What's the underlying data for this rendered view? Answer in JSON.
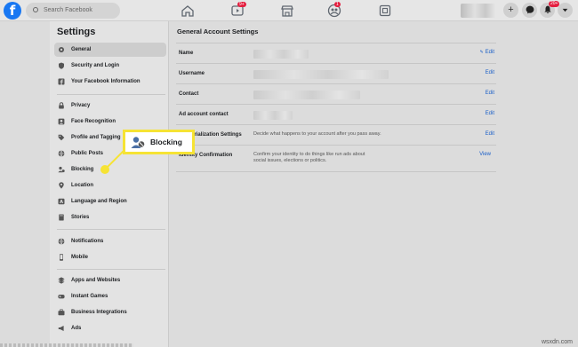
{
  "topbar": {
    "search_placeholder": "Search Facebook",
    "video_badge": "9+",
    "groups_badge": "1",
    "bell_badge": "20+"
  },
  "sidebar": {
    "title": "Settings",
    "items": [
      {
        "label": "General",
        "icon": "gear-icon"
      },
      {
        "label": "Security and Login",
        "icon": "shield-icon"
      },
      {
        "label": "Your Facebook Information",
        "icon": "facebook-icon"
      },
      {
        "label": "Privacy",
        "icon": "lock-icon"
      },
      {
        "label": "Face Recognition",
        "icon": "face-icon"
      },
      {
        "label": "Profile and Tagging",
        "icon": "tag-icon"
      },
      {
        "label": "Public Posts",
        "icon": "globe-icon"
      },
      {
        "label": "Blocking",
        "icon": "block-user-icon"
      },
      {
        "label": "Location",
        "icon": "pin-icon"
      },
      {
        "label": "Language and Region",
        "icon": "language-icon"
      },
      {
        "label": "Stories",
        "icon": "book-icon"
      },
      {
        "label": "Notifications",
        "icon": "globe-icon"
      },
      {
        "label": "Mobile",
        "icon": "phone-icon"
      },
      {
        "label": "Apps and Websites",
        "icon": "apps-icon"
      },
      {
        "label": "Instant Games",
        "icon": "game-icon"
      },
      {
        "label": "Business Integrations",
        "icon": "briefcase-icon"
      },
      {
        "label": "Ads",
        "icon": "megaphone-icon"
      }
    ]
  },
  "main": {
    "title": "General Account Settings",
    "rows": [
      {
        "label": "Name",
        "action": "Edit"
      },
      {
        "label": "Username",
        "action": "Edit"
      },
      {
        "label": "Contact",
        "action": "Edit"
      },
      {
        "label": "Ad account contact",
        "action": "Edit"
      },
      {
        "label": "Memorialization Settings",
        "description": "Decide what happens to your account after you pass away.",
        "action": "Edit"
      },
      {
        "label": "Identity Confirmation",
        "description": "Confirm your identity to do things like run ads about social issues, elections or politics.",
        "action": "View"
      }
    ]
  },
  "callout": {
    "label": "Blocking",
    "color": "#f6e334"
  },
  "watermark": "wsxdn.com"
}
